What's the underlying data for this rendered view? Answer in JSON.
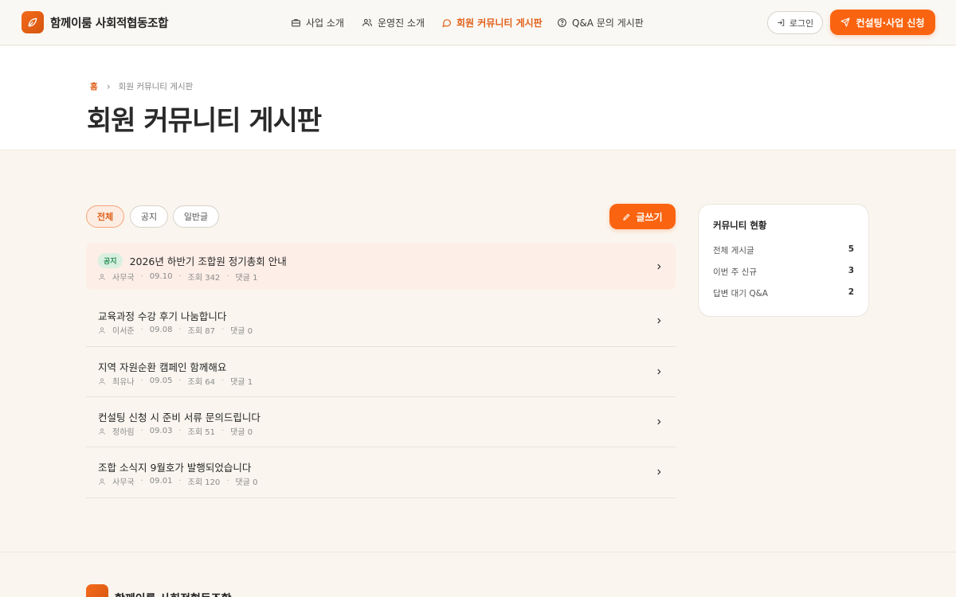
{
  "brand": {
    "name": "함께이룸 사회적협동조합",
    "color": "#fa6410"
  },
  "nav": [
    {
      "label": "사업 소개",
      "icon": "briefcase-icon"
    },
    {
      "label": "운영진 소개",
      "icon": "users-icon"
    },
    {
      "label": "회원 커뮤니티 게시판",
      "icon": "chat-icon",
      "active": true
    },
    {
      "label": "Q&A 문의 게시판",
      "icon": "help-circle-icon"
    }
  ],
  "header": {
    "login_label": "로그인",
    "apply_label": "컨설팅·사업 신청"
  },
  "breadcrumb": {
    "home": "홈",
    "current": "회원 커뮤니티 게시판"
  },
  "page_title": "회원 커뮤니티 게시판",
  "filters": [
    {
      "label": "전체",
      "active": true
    },
    {
      "label": "공지"
    },
    {
      "label": "일반글"
    }
  ],
  "write_label": "글쓰기",
  "posts": [
    {
      "badge": "공지",
      "title": "2026년 하반기 조합원 정기총회 안내",
      "author": "사무국",
      "date": "09.10",
      "views": "조회 342",
      "comments": "댓글 1"
    },
    {
      "title": "교육과정 수강 후기 나눔합니다",
      "author": "이서준",
      "date": "09.08",
      "views": "조회 87",
      "comments": "댓글 0"
    },
    {
      "title": "지역 자원순환 캠페인 함께해요",
      "author": "최유나",
      "date": "09.05",
      "views": "조회 64",
      "comments": "댓글 1"
    },
    {
      "title": "컨설팅 신청 시 준비 서류 문의드립니다",
      "author": "정하림",
      "date": "09.03",
      "views": "조회 51",
      "comments": "댓글 0"
    },
    {
      "title": "조합 소식지 9월호가 발행되었습니다",
      "author": "사무국",
      "date": "09.01",
      "views": "조회 120",
      "comments": "댓글 0"
    }
  ],
  "sidebar": {
    "title": "커뮤니티 현황",
    "stats": [
      {
        "label": "전체 게시글",
        "value": "5"
      },
      {
        "label": "이번 주 신규",
        "value": "3"
      },
      {
        "label": "답변 대기 Q&A",
        "value": "2"
      }
    ]
  },
  "footer": {
    "brand": "함께이룸 사회적협동조합"
  }
}
